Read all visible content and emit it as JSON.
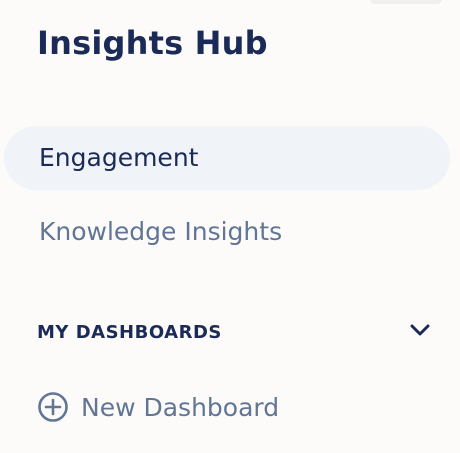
{
  "app": {
    "title": "Insights Hub"
  },
  "nav": {
    "items": [
      {
        "label": "Engagement",
        "active": true
      },
      {
        "label": "Knowledge Insights",
        "active": false
      }
    ]
  },
  "dashboards": {
    "section_label": "MY DASHBOARDS",
    "expand_icon": "chevron-down-icon",
    "new_label": "New Dashboard",
    "new_icon": "plus-circle-icon"
  },
  "colors": {
    "background": "#fcfbfa",
    "primary_text": "#1b2b57",
    "secondary_text": "#617595",
    "active_item_bg": "#f0f3f7"
  }
}
